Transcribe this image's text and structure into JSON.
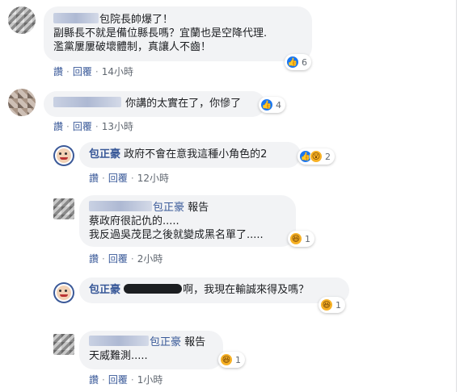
{
  "actions": {
    "like": "讚",
    "reply": "回覆",
    "dot": "·"
  },
  "comments": [
    {
      "text_lines": [
        "包院長帥爆了！",
        "副縣長不就是備位縣長嗎？宜蘭也是空降代理.",
        "濫黨屢屢破壞體制，真讓人不齒！"
      ],
      "reaction_count": "6",
      "time": "14小時"
    },
    {
      "text": "你講的太實在了，你慘了",
      "reaction_count": "4",
      "time": "13小時"
    },
    {
      "author": "包正豪",
      "text": "政府不會在意我這種小角色的2",
      "reaction_count": "2",
      "time": "12小時"
    },
    {
      "mention": "包正豪",
      "text_lines": [
        "報告",
        "蔡政府很記仇的.....",
        "我反過吳茂昆之後就變成黑名單了....."
      ],
      "reaction_count": "1",
      "time": "2小時"
    },
    {
      "author": "包正豪",
      "text": "啊，我現在輸誠來得及嗎？",
      "reaction_count": "1",
      "time": "1小時"
    },
    {
      "mention": "包正豪",
      "text_lines": [
        "報告",
        "天威難測....."
      ],
      "reaction_count": "1",
      "time": "1小時"
    }
  ],
  "colors": {
    "bubble": "#f2f3f5",
    "link": "#385898",
    "meta": "#606770",
    "like_blue": "#1877f2",
    "emoji_yellow": "#f7b125"
  }
}
